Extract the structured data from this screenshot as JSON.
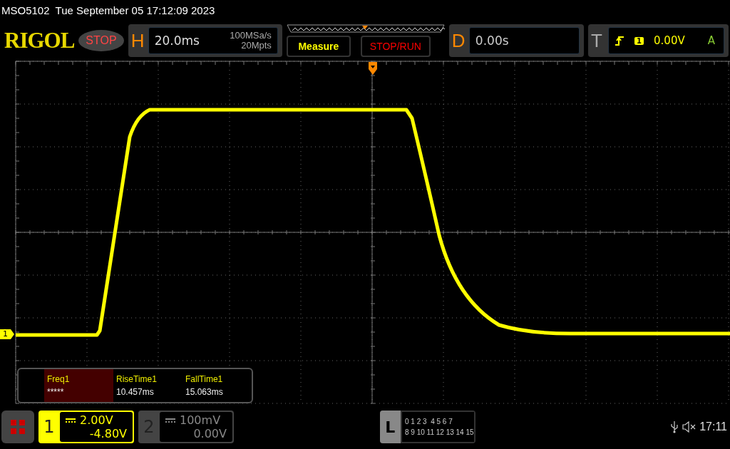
{
  "title_bar": "MSO5102  Tue September 05 17:12:09 2023",
  "logo": "RIGOL",
  "run_state": "STOP",
  "horizontal": {
    "label": "H",
    "timebase": "20.0ms",
    "sample_rate": "100MSa/s",
    "memory_depth": "20Mpts"
  },
  "buttons": [
    {
      "label": "Measure",
      "kind": "menu"
    },
    {
      "label": "STOP/RUN",
      "kind": "action"
    }
  ],
  "delay": {
    "label": "D",
    "value": "0.00s"
  },
  "trigger": {
    "label": "T",
    "source": "1",
    "level": "0.00V",
    "mode": "A"
  },
  "channel_marker": "1",
  "measurements": [
    {
      "name": "Freq1",
      "value": "*****",
      "selected": true
    },
    {
      "name": "RiseTime1",
      "value": "10.457ms",
      "selected": false
    },
    {
      "name": "FallTime1",
      "value": "15.063ms",
      "selected": false
    }
  ],
  "channels": [
    {
      "number": "1",
      "scale": "2.00V",
      "offset": "-4.80V",
      "on": true
    },
    {
      "number": "2",
      "scale": "100mV",
      "offset": "0.00V",
      "on": false
    }
  ],
  "logic": {
    "label": "L",
    "rows": [
      "0 1 2 3  4 5 6 7",
      "8 9 10 11 12 13 14 15"
    ]
  },
  "status": {
    "time": "17:11"
  }
}
